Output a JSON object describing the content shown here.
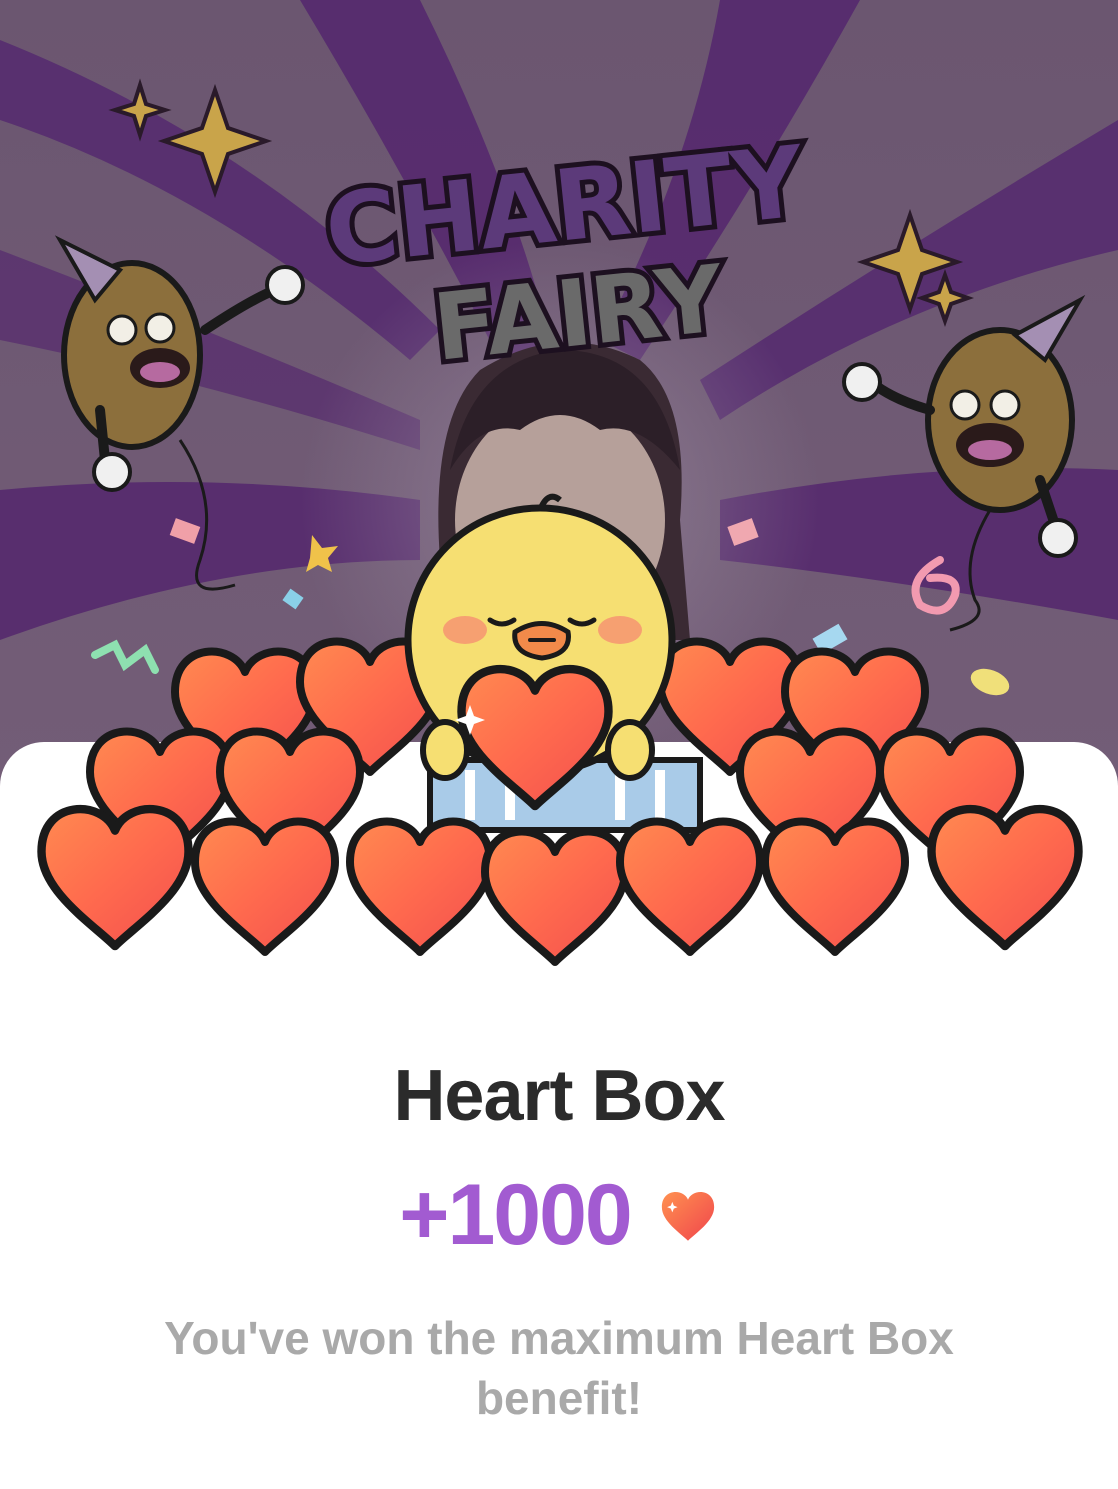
{
  "banner": {
    "headline_line1": "CHARITY",
    "headline_line2": "FAIRY"
  },
  "reward": {
    "title": "Heart Box",
    "amount": "+1000",
    "icon": "heart-icon",
    "accent_color": "#a25bd1",
    "message": "You've won the maximum Heart Box benefit!"
  }
}
